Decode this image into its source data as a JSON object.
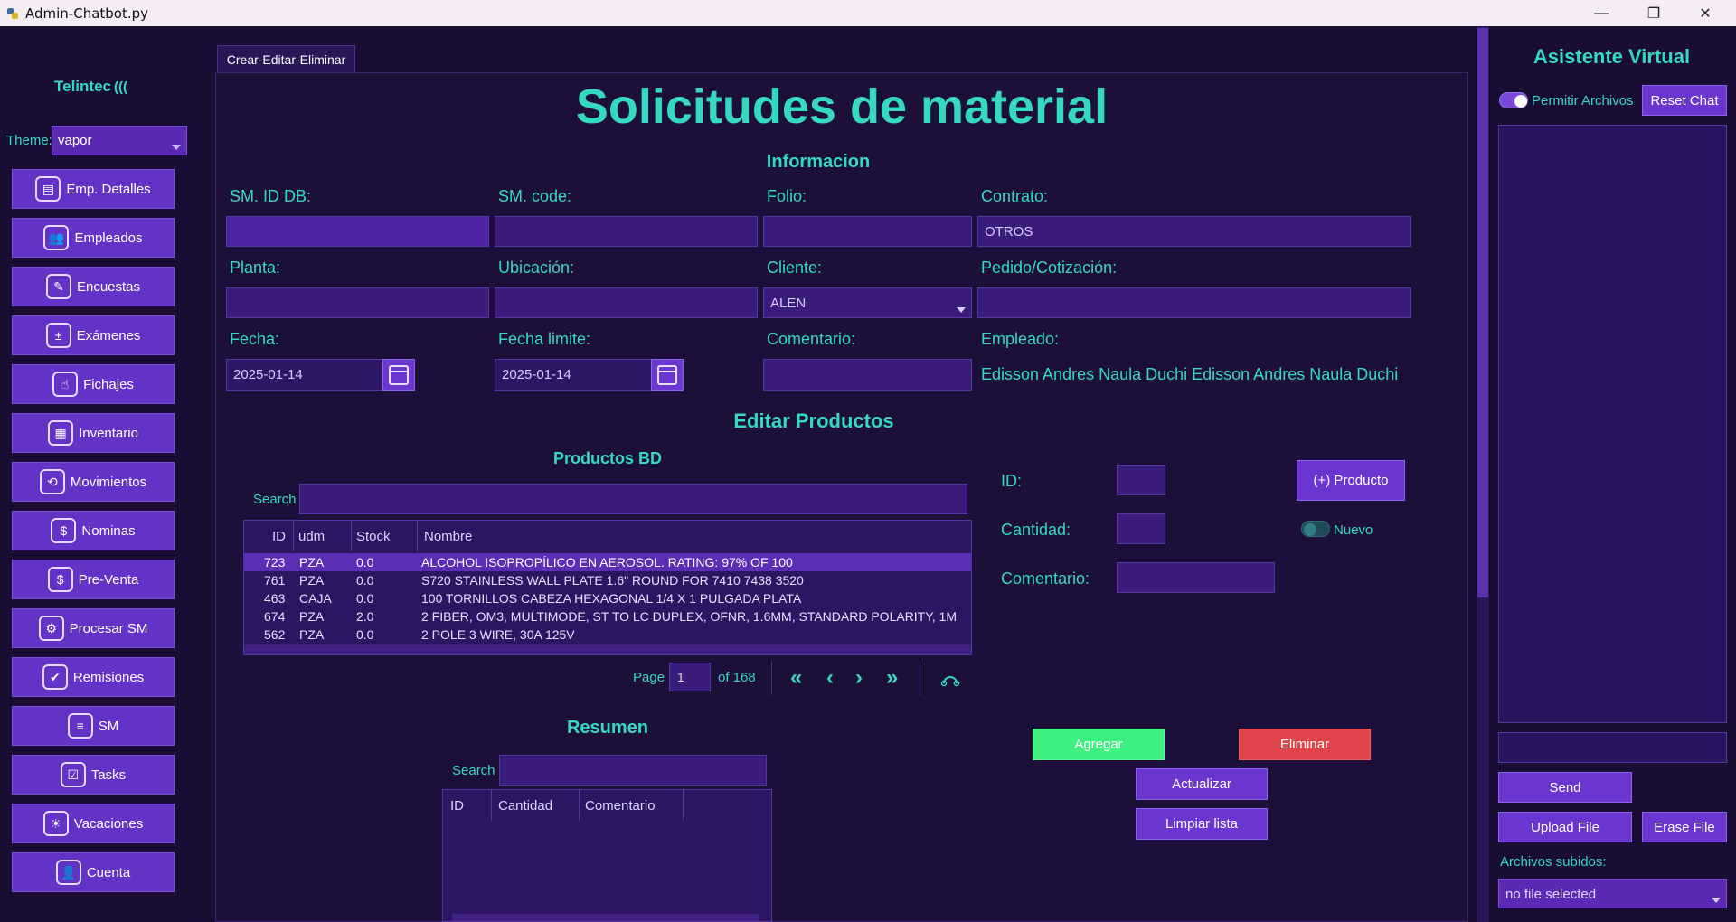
{
  "window": {
    "title": "Admin-Chatbot.py",
    "controls": [
      "—",
      "❐",
      "✕"
    ]
  },
  "sidebar": {
    "logo": "Telintec",
    "theme_label": "Theme:",
    "theme_value": "vapor",
    "items": [
      {
        "label": "Emp. Detalles",
        "icon": "id-card-icon",
        "glyph": "▤"
      },
      {
        "label": "Empleados",
        "icon": "people-icon",
        "glyph": "👥"
      },
      {
        "label": "Encuestas",
        "icon": "survey-icon",
        "glyph": "✎"
      },
      {
        "label": "Exámenes",
        "icon": "exam-icon",
        "glyph": "±"
      },
      {
        "label": "Fichajes",
        "icon": "clock-in-icon",
        "glyph": "☝"
      },
      {
        "label": "Inventario",
        "icon": "boxes-icon",
        "glyph": "▦"
      },
      {
        "label": "Movimientos",
        "icon": "movements-icon",
        "glyph": "⟲"
      },
      {
        "label": "Nominas",
        "icon": "payroll-icon",
        "glyph": "$"
      },
      {
        "label": "Pre-Venta",
        "icon": "presale-icon",
        "glyph": "$"
      },
      {
        "label": "Procesar SM",
        "icon": "process-icon",
        "glyph": "⚙"
      },
      {
        "label": "Remisiones",
        "icon": "remission-icon",
        "glyph": "✔"
      },
      {
        "label": "SM",
        "icon": "sm-icon",
        "glyph": "≡"
      },
      {
        "label": "Tasks",
        "icon": "tasks-icon",
        "glyph": "☑"
      },
      {
        "label": "Vacaciones",
        "icon": "vacation-icon",
        "glyph": "☀"
      },
      {
        "label": "Cuenta",
        "icon": "user-icon",
        "glyph": "👤"
      }
    ]
  },
  "tab": {
    "label": "Crear-Editar-Eliminar"
  },
  "main": {
    "title": "Solicitudes de material",
    "info_title": "Informacion",
    "labels": {
      "sm_id": "SM. ID DB:",
      "sm_code": "SM. code:",
      "folio": "Folio:",
      "contrato": "Contrato:",
      "planta": "Planta:",
      "ubicacion": "Ubicación:",
      "cliente": "Cliente:",
      "pedido": "Pedido/Cotización:",
      "fecha": "Fecha:",
      "fecha_limite": "Fecha limite:",
      "comentario": "Comentario:",
      "empleado": "Empleado:"
    },
    "values": {
      "sm_id": "",
      "sm_code": "",
      "folio": "",
      "contrato": "OTROS",
      "planta": "",
      "ubicacion": "",
      "cliente": "ALEN",
      "pedido": "",
      "fecha": "2025-01-14",
      "fecha_limite": "2025-01-14",
      "comentario": "",
      "empleado": "Edisson Andres  Naula Duchi Edisson Andres  Naula Duchi"
    },
    "edit_title": "Editar Productos",
    "products_title": "Productos BD",
    "search_label": "Search",
    "table": {
      "headers": [
        "ID",
        "udm",
        "Stock",
        "Nombre"
      ],
      "rows": [
        [
          "723",
          "PZA",
          "0.0",
          "ALCOHOL ISOPROPÍLICO EN AEROSOL. RATING: 97% OF 100"
        ],
        [
          "761",
          "PZA",
          "0.0",
          " S720 STAINLESS WALL PLATE 1.6\" ROUND FOR 7410 7438 3520"
        ],
        [
          "463",
          "CAJA",
          "0.0",
          "100 TORNILLOS CABEZA HEXAGONAL 1/4 X 1 PULGADA PLATA"
        ],
        [
          "674",
          "PZA",
          "2.0",
          "2 FIBER, OM3, MULTIMODE, ST TO LC DUPLEX, OFNR, 1.6MM, STANDARD POLARITY, 1M"
        ],
        [
          "562",
          "PZA",
          "0.0",
          "2 POLE 3 WIRE, 30A 125V"
        ]
      ]
    },
    "pager": {
      "page_label": "Page",
      "page_value": "1",
      "of_label": "of 168",
      "first": "«",
      "prev": "‹",
      "next": "›",
      "last": "»"
    },
    "summary_title": "Resumen",
    "summary_search_label": "Search",
    "summary_headers": [
      "ID",
      "Cantidad",
      "Comentario"
    ],
    "form": {
      "id_label": "ID:",
      "cantidad_label": "Cantidad:",
      "comentario_label": "Comentario:",
      "add_product": "(+) Producto",
      "nuevo": "Nuevo",
      "agregar": "Agregar",
      "eliminar": "Eliminar",
      "actualizar": "Actualizar",
      "limpiar": "Limpiar lista"
    }
  },
  "chat": {
    "title": "Asistente Virtual",
    "permitir": "Permitir Archivos",
    "reset": "Reset Chat",
    "send": "Send",
    "upload": "Upload File",
    "erase": "Erase File",
    "files_label": "Archivos subidos:",
    "files_value": "no file selected"
  },
  "colors": {
    "accent": "#35d9c0",
    "button": "#6a36cf",
    "agregar": "#3ef07f",
    "eliminar": "#e0434a",
    "background": "#190d33"
  }
}
